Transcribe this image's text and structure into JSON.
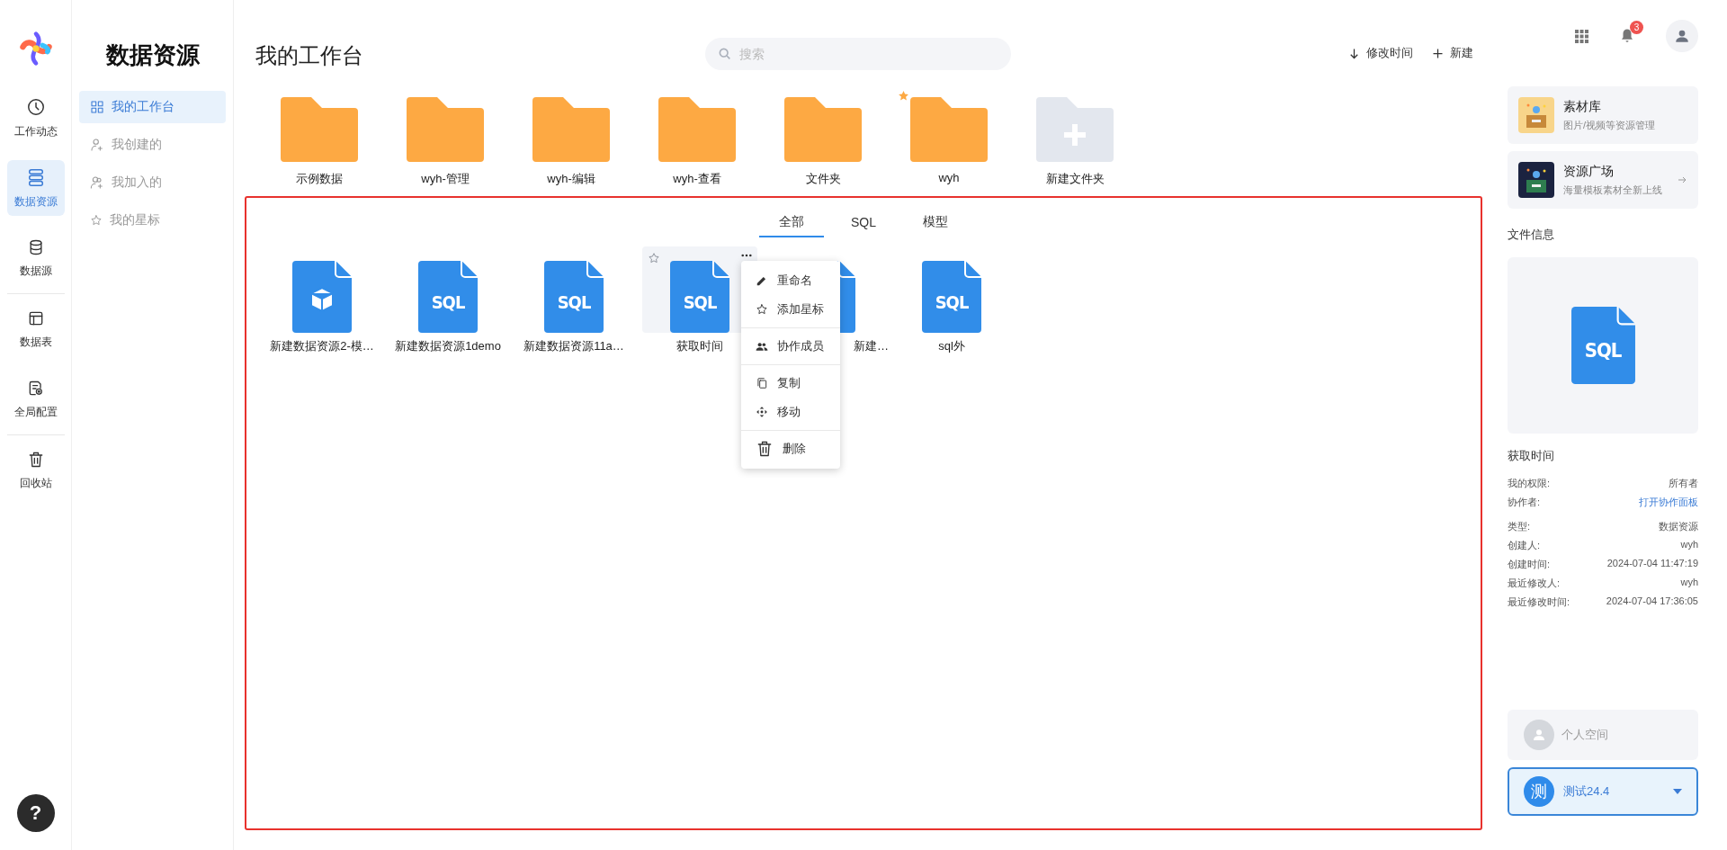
{
  "rail": {
    "items": [
      {
        "label": "工作动态",
        "selected": false
      },
      {
        "label": "数据资源",
        "selected": true
      },
      {
        "label": "数据源",
        "selected": false
      },
      {
        "label": "数据表",
        "selected": false
      },
      {
        "label": "全局配置",
        "selected": false
      },
      {
        "label": "回收站",
        "selected": false
      }
    ],
    "help": "?"
  },
  "sidebar": {
    "title": "数据资源",
    "items": [
      {
        "label": "我的工作台",
        "selected": true
      },
      {
        "label": "我创建的",
        "selected": false
      },
      {
        "label": "我加入的",
        "selected": false
      },
      {
        "label": "我的星标",
        "selected": false
      }
    ]
  },
  "main": {
    "title": "我的工作台",
    "search": {
      "placeholder": "搜索"
    },
    "sort": "修改时间",
    "new": "新建",
    "folders": [
      {
        "name": "示例数据",
        "kind": "folder",
        "starred": false
      },
      {
        "name": "wyh-管理",
        "kind": "folder",
        "starred": false
      },
      {
        "name": "wyh-编辑",
        "kind": "folder",
        "starred": false
      },
      {
        "name": "wyh-查看",
        "kind": "folder",
        "starred": false
      },
      {
        "name": "文件夹",
        "kind": "folder",
        "starred": false
      },
      {
        "name": "wyh",
        "kind": "folder",
        "starred": true
      },
      {
        "name": "新建文件夹",
        "kind": "new",
        "starred": false
      }
    ],
    "tabs": [
      {
        "label": "全部",
        "selected": true
      },
      {
        "label": "SQL",
        "selected": false
      },
      {
        "label": "模型",
        "selected": false
      }
    ],
    "files": [
      {
        "name": "新建数据资源2-模…",
        "kind": "model",
        "hovered": false
      },
      {
        "name": "新建数据资源1demo",
        "kind": "sql",
        "badge": "SQL",
        "hovered": false
      },
      {
        "name": "新建数据资源11a…",
        "kind": "sql",
        "badge": "SQL",
        "hovered": false
      },
      {
        "name": "获取时间",
        "kind": "sql",
        "badge": "SQL",
        "hovered": true
      },
      {
        "name": "新建…",
        "kind": "sql",
        "hovered": false
      },
      {
        "name": "sql外",
        "kind": "sql",
        "badge": "SQL",
        "hovered": false
      }
    ],
    "context_menu": [
      [
        {
          "label": "重命名"
        },
        {
          "label": "添加星标"
        }
      ],
      [
        {
          "label": "协作成员"
        }
      ],
      [
        {
          "label": "复制"
        },
        {
          "label": "移动"
        }
      ],
      [
        {
          "label": "删除"
        }
      ]
    ]
  },
  "header": {
    "notification_count": "3"
  },
  "right_panel": {
    "cards": [
      {
        "title": "素材库",
        "subtitle": "图片/视频等资源管理",
        "arrow": false
      },
      {
        "title": "资源广场",
        "subtitle": "海量模板素材全新上线",
        "arrow": true
      }
    ],
    "info_title": "文件信息",
    "preview_badge": "SQL",
    "file_name": "获取时间",
    "details": [
      [
        {
          "label": "我的权限:",
          "value": "所有者",
          "link": false
        },
        {
          "label": "协作者:",
          "value": "打开协作面板",
          "link": true
        }
      ],
      [
        {
          "label": "类型:",
          "value": "数据资源",
          "link": false
        },
        {
          "label": "创建人:",
          "value": "wyh",
          "link": false
        },
        {
          "label": "创建时间:",
          "value": "2024-07-04 11:47:19",
          "link": false
        },
        {
          "label": "最近修改人:",
          "value": "wyh",
          "link": false
        },
        {
          "label": "最近修改时间:",
          "value": "2024-07-04 17:36:05",
          "link": false
        }
      ]
    ],
    "personal_space": "个人空间",
    "team": {
      "avatar": "测",
      "name": "测试24.4"
    }
  }
}
